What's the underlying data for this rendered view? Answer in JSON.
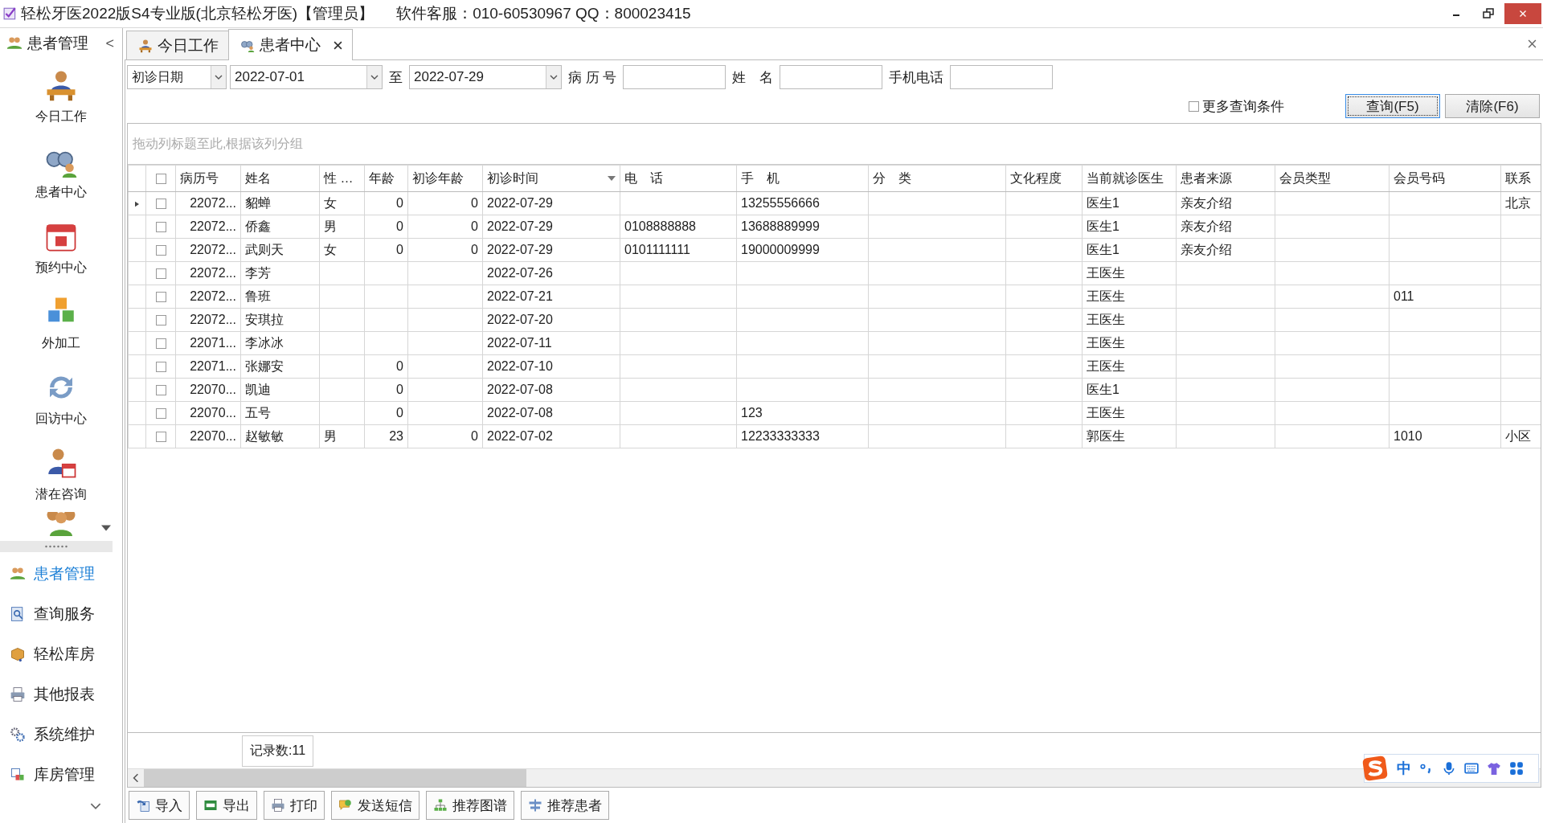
{
  "window": {
    "title": "轻松牙医2022版S4专业版(北京轻松牙医)【管理员】",
    "support": "软件客服：010-60530967 QQ：800023415"
  },
  "sidebar": {
    "header": "患者管理",
    "collapse": "<",
    "big_items": [
      {
        "label": "今日工作",
        "kind": "desk"
      },
      {
        "label": "患者中心",
        "kind": "binoculars"
      },
      {
        "label": "预约中心",
        "kind": "calendar"
      },
      {
        "label": "外加工",
        "kind": "cubes"
      },
      {
        "label": "回访中心",
        "kind": "refresh"
      },
      {
        "label": "潜在咨询",
        "kind": "consult"
      },
      {
        "kind": "group"
      }
    ],
    "nav_items": [
      {
        "label": "患者管理",
        "kind": "people",
        "selected": true
      },
      {
        "label": "查询服务",
        "kind": "search",
        "selected": false
      },
      {
        "label": "轻松库房",
        "kind": "box",
        "selected": false
      },
      {
        "label": "其他报表",
        "kind": "printer",
        "selected": false
      },
      {
        "label": "系统维护",
        "kind": "gears",
        "selected": false
      },
      {
        "label": "库房管理",
        "kind": "stock",
        "selected": false
      }
    ]
  },
  "tabs": [
    {
      "label": "今日工作",
      "kind": "desk",
      "selected": false,
      "closable": false
    },
    {
      "label": "患者中心",
      "kind": "binoculars",
      "selected": true,
      "closable": true
    }
  ],
  "filters": {
    "date_type": "初诊日期",
    "date_from": "2022-07-01",
    "to_label": "至",
    "date_to": "2022-07-29",
    "record_label": "病 历 号",
    "name_label": "姓　名",
    "phone_label": "手机电话",
    "more_label": "更多查询条件",
    "more_checked": false,
    "buttons": [
      {
        "label": "查询(F5)",
        "focused": true
      },
      {
        "label": "清除(F6)",
        "focused": false
      }
    ]
  },
  "table": {
    "group_hint": "拖动列标题至此,根据该列分组",
    "header_checked": false,
    "columns": [
      {
        "label": "病历号",
        "filter": false
      },
      {
        "label": "姓名",
        "filter": false
      },
      {
        "label": "性 …",
        "filter": false
      },
      {
        "label": "年龄",
        "filter": false
      },
      {
        "label": "初诊年龄",
        "filter": false
      },
      {
        "label": "初诊时间",
        "filter": true
      },
      {
        "label": "电　话",
        "filter": false
      },
      {
        "label": "手　机",
        "filter": false
      },
      {
        "label": "分　类",
        "filter": false
      },
      {
        "label": "文化程度",
        "filter": false
      },
      {
        "label": "当前就诊医生",
        "filter": false
      },
      {
        "label": "患者来源",
        "filter": false
      },
      {
        "label": "会员类型",
        "filter": false
      },
      {
        "label": "会员号码",
        "filter": false
      },
      {
        "label": "联系",
        "filter": false
      }
    ],
    "rows": [
      {
        "selected": true,
        "checked": false,
        "cells": [
          "22072...",
          "貂蝉",
          "女",
          "0",
          "0",
          "2022-07-29",
          null,
          "13255556666",
          null,
          null,
          "医生1",
          "亲友介绍",
          null,
          null,
          "北京"
        ]
      },
      {
        "selected": false,
        "checked": false,
        "cells": [
          "22072...",
          "侨鑫",
          "男",
          "0",
          "0",
          "2022-07-29",
          "0108888888",
          "13688889999",
          null,
          null,
          "医生1",
          "亲友介绍",
          null,
          null,
          null
        ]
      },
      {
        "selected": false,
        "checked": false,
        "cells": [
          "22072...",
          "武则天",
          "女",
          "0",
          "0",
          "2022-07-29",
          "0101111111",
          "19000009999",
          null,
          null,
          "医生1",
          "亲友介绍",
          null,
          null,
          null
        ]
      },
      {
        "selected": false,
        "checked": false,
        "cells": [
          "22072...",
          "李芳",
          null,
          null,
          null,
          "2022-07-26",
          null,
          null,
          null,
          null,
          "王医生",
          null,
          null,
          null,
          null
        ]
      },
      {
        "selected": false,
        "checked": false,
        "cells": [
          "22072...",
          "鲁班",
          null,
          null,
          null,
          "2022-07-21",
          null,
          null,
          null,
          null,
          "王医生",
          null,
          null,
          "011",
          null
        ]
      },
      {
        "selected": false,
        "checked": false,
        "cells": [
          "22072...",
          "安琪拉",
          null,
          null,
          null,
          "2022-07-20",
          null,
          null,
          null,
          null,
          "王医生",
          null,
          null,
          null,
          null
        ]
      },
      {
        "selected": false,
        "checked": false,
        "cells": [
          "22071...",
          "李冰冰",
          null,
          null,
          null,
          "2022-07-11",
          null,
          null,
          null,
          null,
          "王医生",
          null,
          null,
          null,
          null
        ]
      },
      {
        "selected": false,
        "checked": false,
        "cells": [
          "22071...",
          "张娜安",
          null,
          "0",
          null,
          "2022-07-10",
          null,
          null,
          null,
          null,
          "王医生",
          null,
          null,
          null,
          null
        ]
      },
      {
        "selected": false,
        "checked": false,
        "cells": [
          "22070...",
          "凯迪",
          null,
          "0",
          null,
          "2022-07-08",
          null,
          null,
          null,
          null,
          "医生1",
          null,
          null,
          null,
          null
        ]
      },
      {
        "selected": false,
        "checked": false,
        "cells": [
          "22070...",
          "五号",
          null,
          "0",
          null,
          "2022-07-08",
          null,
          "123",
          null,
          null,
          "王医生",
          null,
          null,
          null,
          null
        ]
      },
      {
        "selected": false,
        "checked": false,
        "cells": [
          "22070...",
          "赵敏敏",
          "男",
          "23",
          "0",
          "2022-07-02",
          null,
          "12233333333",
          null,
          null,
          "郭医生",
          null,
          null,
          "1010",
          "小区"
        ]
      }
    ],
    "record_count": "记录数:11"
  },
  "toolbar": [
    {
      "label": "导入",
      "kind": "import"
    },
    {
      "label": "导出",
      "kind": "xls"
    },
    {
      "label": "打印",
      "kind": "printer"
    },
    {
      "label": "发送短信",
      "kind": "sms"
    },
    {
      "label": "推荐图谱",
      "kind": "tree"
    },
    {
      "label": "推荐患者",
      "kind": "split"
    }
  ],
  "ime_bar": {
    "mode": "中"
  }
}
